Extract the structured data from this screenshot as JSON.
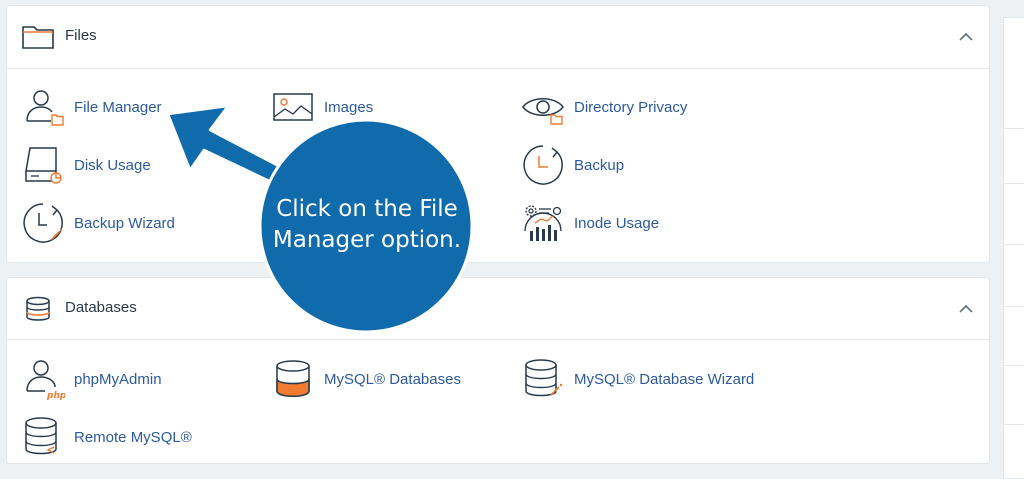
{
  "sections": [
    {
      "title": "Files",
      "items": [
        {
          "label": "File Manager",
          "icon": "file-manager-icon"
        },
        {
          "label": "Images",
          "icon": "images-icon"
        },
        {
          "label": "Directory Privacy",
          "icon": "directory-privacy-icon"
        },
        {
          "label": "Disk Usage",
          "icon": "disk-usage-icon"
        },
        {
          "label": "Backup",
          "icon": "backup-icon"
        },
        {
          "label": "Backup Wizard",
          "icon": "backup-wizard-icon"
        },
        {
          "label": "Inode Usage",
          "icon": "inode-usage-icon"
        }
      ]
    },
    {
      "title": "Databases",
      "items": [
        {
          "label": "phpMyAdmin",
          "icon": "phpmyadmin-icon"
        },
        {
          "label": "MySQL® Databases",
          "icon": "mysql-databases-icon"
        },
        {
          "label": "MySQL® Database Wizard",
          "icon": "mysql-database-wizard-icon"
        },
        {
          "label": "Remote MySQL®",
          "icon": "remote-mysql-icon"
        }
      ]
    }
  ],
  "callout": {
    "line1": "Click on the File",
    "line2": "Manager option."
  },
  "colors": {
    "link": "#2c5aa0",
    "accent": "#f07b33",
    "callout": "#0f6bab"
  }
}
